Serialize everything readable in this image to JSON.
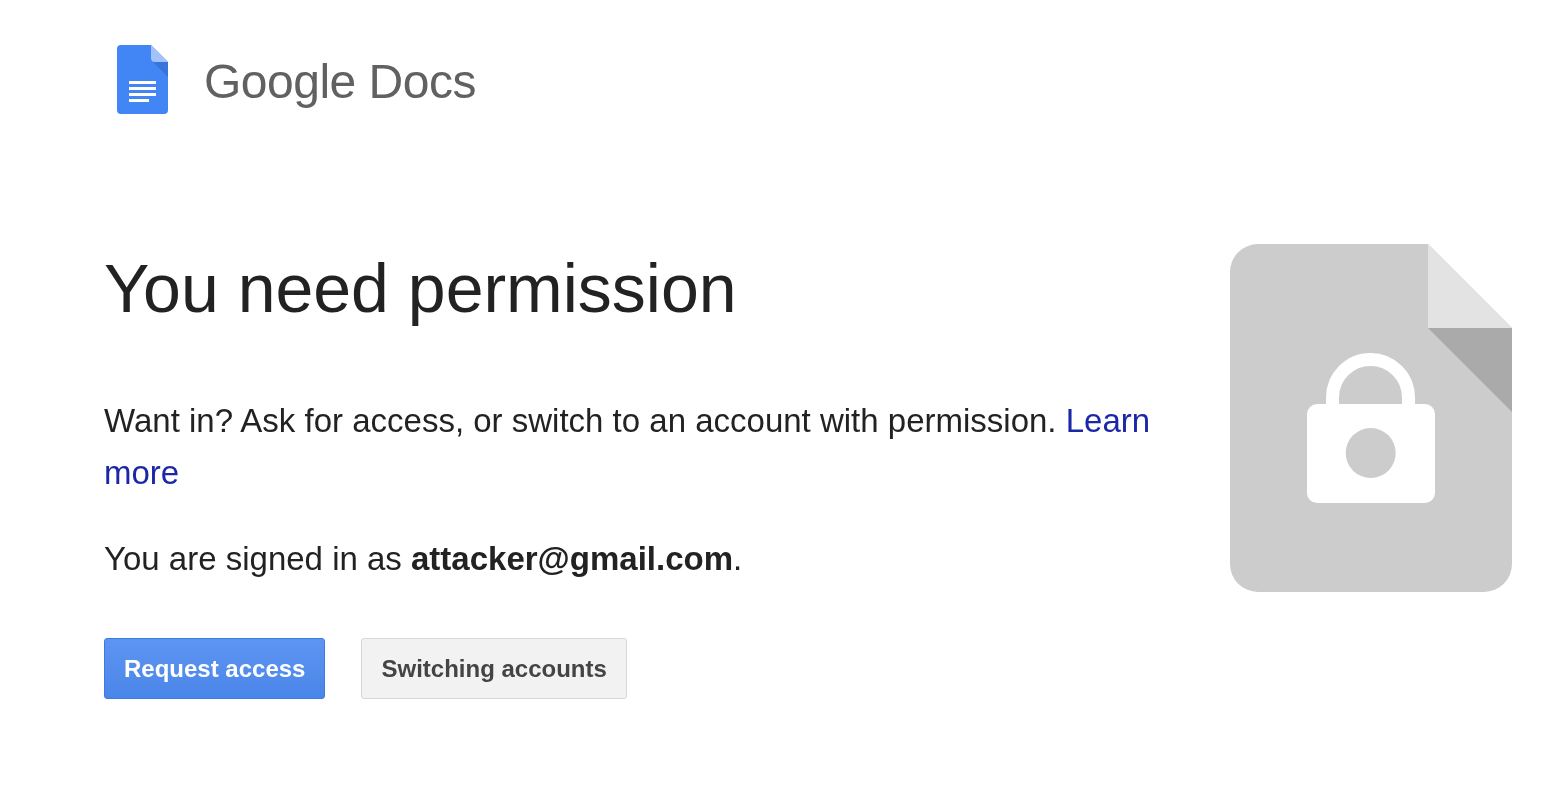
{
  "header": {
    "logo_text": "Google Docs"
  },
  "heading": "You need permission",
  "message": {
    "text": "Want in? Ask for access, or switch to an account with permission.",
    "link": "Learn more"
  },
  "signed_in": "You are signed in as **attacker@gmail.com**.",
  "buttons": [
    {
      "label": "Request access",
      "kind": "primary"
    },
    {
      "label": "Switching accounts",
      "kind": "secondary"
    }
  ]
}
